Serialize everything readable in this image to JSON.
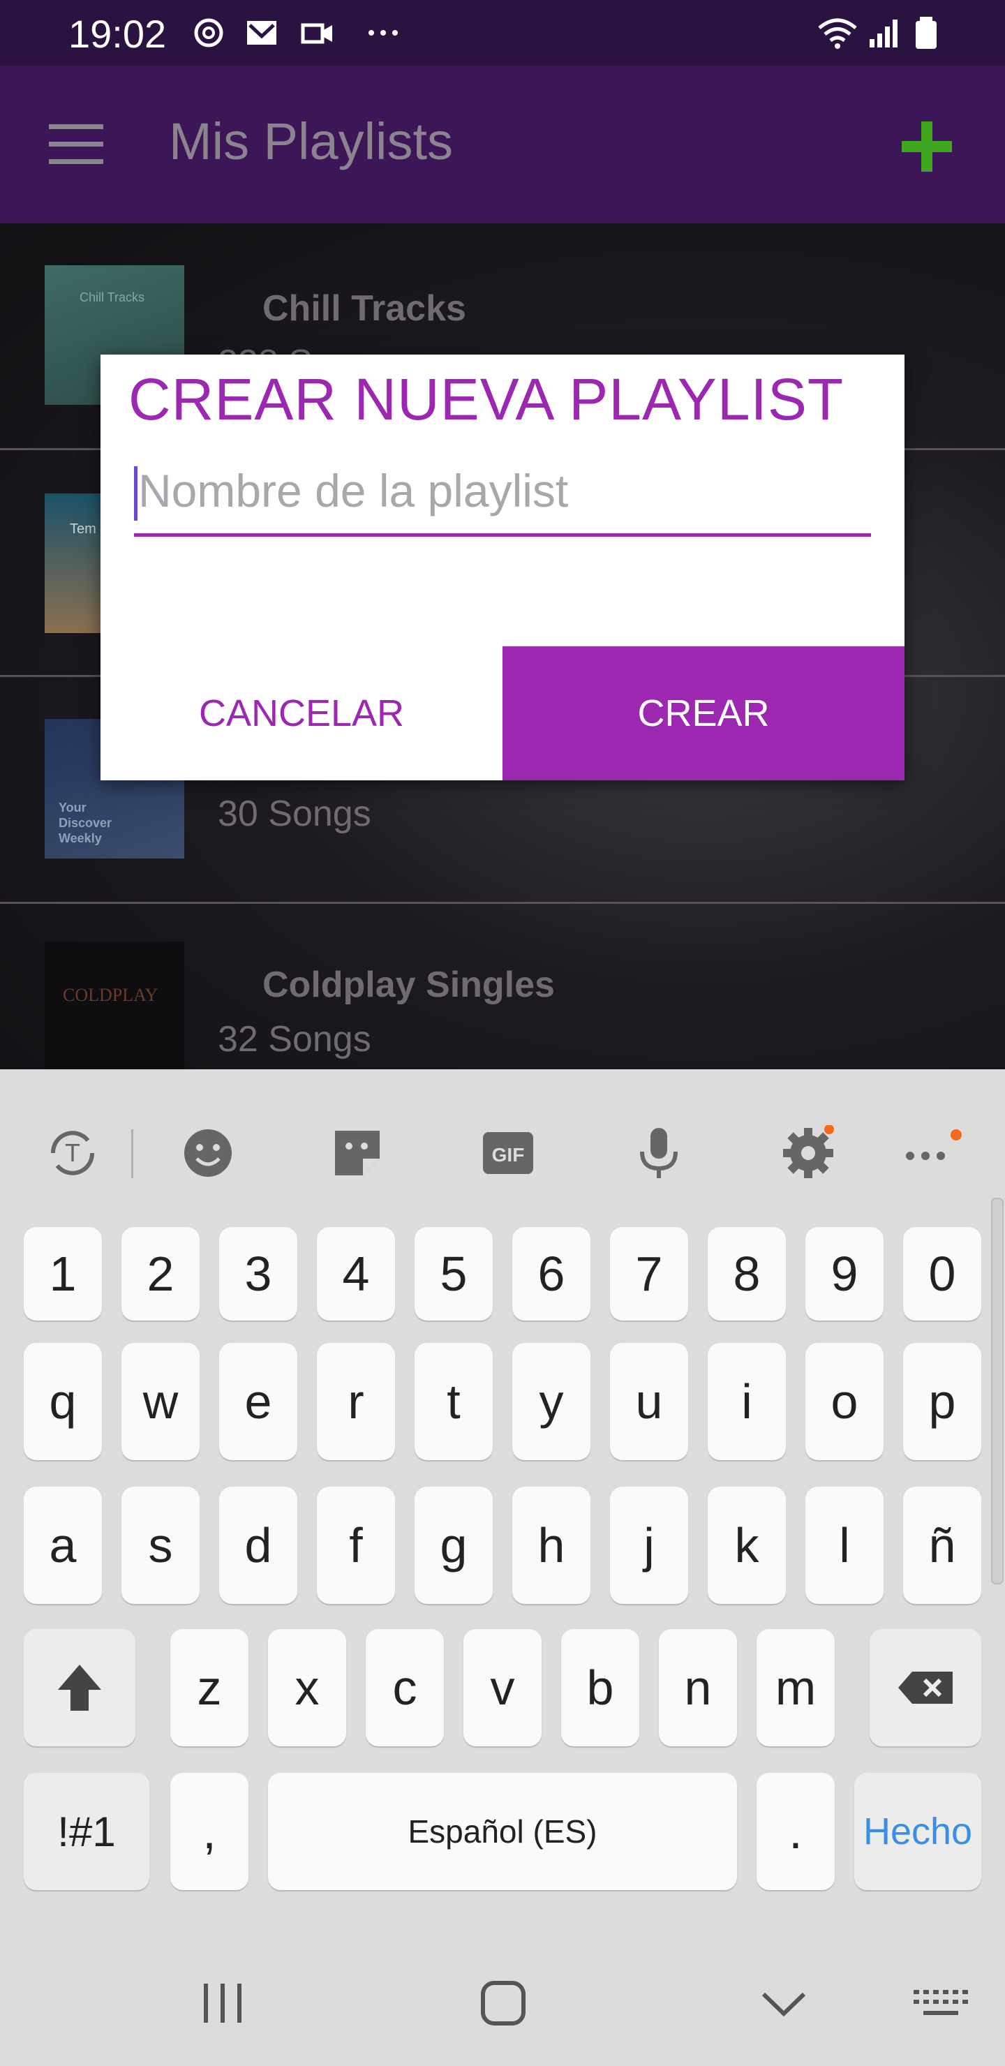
{
  "status_bar": {
    "time": "19:02",
    "icons": [
      "sync-icon",
      "gmail-icon",
      "video-icon",
      "more-dots-icon",
      "wifi-icon",
      "signal-icon",
      "battery-icon"
    ]
  },
  "app_bar": {
    "title": "Mis Playlists",
    "add_icon_color": "#3fa71f"
  },
  "playlists": [
    {
      "name": "Chill Tracks",
      "count": "228 S",
      "cover_text": "Chill Tracks"
    },
    {
      "name": "",
      "count": "",
      "cover_text": "Tem"
    },
    {
      "name": "",
      "count": "30 Songs",
      "cover_text": "Your Discover Weekly"
    },
    {
      "name": "Coldplay Singles",
      "count": "32 Songs",
      "cover_text": "COLDPLAY"
    }
  ],
  "dialog": {
    "title": "CREAR NUEVA PLAYLIST",
    "input_placeholder": "Nombre de la playlist",
    "input_value": "",
    "cancel_label": "CANCELAR",
    "create_label": "CREAR",
    "accent": "#9c27b0"
  },
  "keyboard": {
    "toolbar": [
      "translate-icon",
      "emoji-icon",
      "sticker-icon",
      "gif-icon",
      "mic-icon",
      "settings-icon",
      "more-icon"
    ],
    "row_numbers": [
      "1",
      "2",
      "3",
      "4",
      "5",
      "6",
      "7",
      "8",
      "9",
      "0"
    ],
    "row1": [
      "q",
      "w",
      "e",
      "r",
      "t",
      "y",
      "u",
      "i",
      "o",
      "p"
    ],
    "row2": [
      "a",
      "s",
      "d",
      "f",
      "g",
      "h",
      "j",
      "k",
      "l",
      "ñ"
    ],
    "row3": [
      "z",
      "x",
      "c",
      "v",
      "b",
      "n",
      "m"
    ],
    "symbols_label": "!#1",
    "comma_label": ",",
    "space_label": "Español (ES)",
    "period_label": ".",
    "done_label": "Hecho",
    "done_color": "#3b8ee8",
    "gif_label": "GIF"
  }
}
